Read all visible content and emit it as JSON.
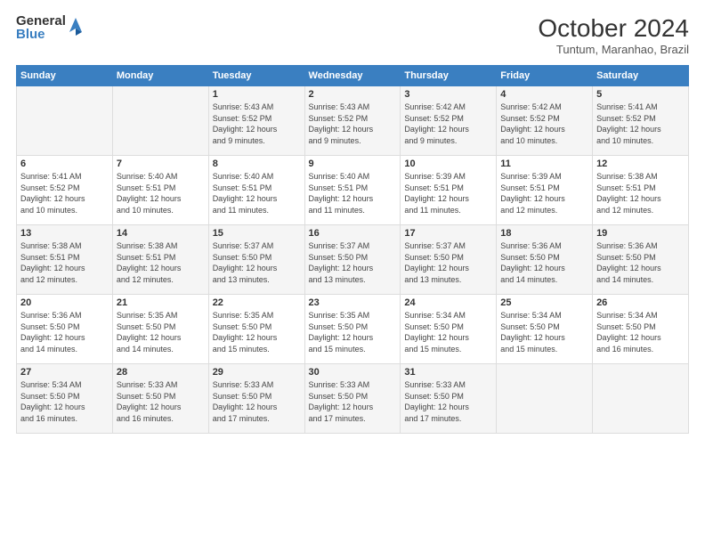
{
  "logo": {
    "general": "General",
    "blue": "Blue"
  },
  "title": "October 2024",
  "location": "Tuntum, Maranhao, Brazil",
  "days_of_week": [
    "Sunday",
    "Monday",
    "Tuesday",
    "Wednesday",
    "Thursday",
    "Friday",
    "Saturday"
  ],
  "weeks": [
    [
      {
        "day": "",
        "info": ""
      },
      {
        "day": "",
        "info": ""
      },
      {
        "day": "1",
        "info": "Sunrise: 5:43 AM\nSunset: 5:52 PM\nDaylight: 12 hours\nand 9 minutes."
      },
      {
        "day": "2",
        "info": "Sunrise: 5:43 AM\nSunset: 5:52 PM\nDaylight: 12 hours\nand 9 minutes."
      },
      {
        "day": "3",
        "info": "Sunrise: 5:42 AM\nSunset: 5:52 PM\nDaylight: 12 hours\nand 9 minutes."
      },
      {
        "day": "4",
        "info": "Sunrise: 5:42 AM\nSunset: 5:52 PM\nDaylight: 12 hours\nand 10 minutes."
      },
      {
        "day": "5",
        "info": "Sunrise: 5:41 AM\nSunset: 5:52 PM\nDaylight: 12 hours\nand 10 minutes."
      }
    ],
    [
      {
        "day": "6",
        "info": "Sunrise: 5:41 AM\nSunset: 5:52 PM\nDaylight: 12 hours\nand 10 minutes."
      },
      {
        "day": "7",
        "info": "Sunrise: 5:40 AM\nSunset: 5:51 PM\nDaylight: 12 hours\nand 10 minutes."
      },
      {
        "day": "8",
        "info": "Sunrise: 5:40 AM\nSunset: 5:51 PM\nDaylight: 12 hours\nand 11 minutes."
      },
      {
        "day": "9",
        "info": "Sunrise: 5:40 AM\nSunset: 5:51 PM\nDaylight: 12 hours\nand 11 minutes."
      },
      {
        "day": "10",
        "info": "Sunrise: 5:39 AM\nSunset: 5:51 PM\nDaylight: 12 hours\nand 11 minutes."
      },
      {
        "day": "11",
        "info": "Sunrise: 5:39 AM\nSunset: 5:51 PM\nDaylight: 12 hours\nand 12 minutes."
      },
      {
        "day": "12",
        "info": "Sunrise: 5:38 AM\nSunset: 5:51 PM\nDaylight: 12 hours\nand 12 minutes."
      }
    ],
    [
      {
        "day": "13",
        "info": "Sunrise: 5:38 AM\nSunset: 5:51 PM\nDaylight: 12 hours\nand 12 minutes."
      },
      {
        "day": "14",
        "info": "Sunrise: 5:38 AM\nSunset: 5:51 PM\nDaylight: 12 hours\nand 12 minutes."
      },
      {
        "day": "15",
        "info": "Sunrise: 5:37 AM\nSunset: 5:50 PM\nDaylight: 12 hours\nand 13 minutes."
      },
      {
        "day": "16",
        "info": "Sunrise: 5:37 AM\nSunset: 5:50 PM\nDaylight: 12 hours\nand 13 minutes."
      },
      {
        "day": "17",
        "info": "Sunrise: 5:37 AM\nSunset: 5:50 PM\nDaylight: 12 hours\nand 13 minutes."
      },
      {
        "day": "18",
        "info": "Sunrise: 5:36 AM\nSunset: 5:50 PM\nDaylight: 12 hours\nand 14 minutes."
      },
      {
        "day": "19",
        "info": "Sunrise: 5:36 AM\nSunset: 5:50 PM\nDaylight: 12 hours\nand 14 minutes."
      }
    ],
    [
      {
        "day": "20",
        "info": "Sunrise: 5:36 AM\nSunset: 5:50 PM\nDaylight: 12 hours\nand 14 minutes."
      },
      {
        "day": "21",
        "info": "Sunrise: 5:35 AM\nSunset: 5:50 PM\nDaylight: 12 hours\nand 14 minutes."
      },
      {
        "day": "22",
        "info": "Sunrise: 5:35 AM\nSunset: 5:50 PM\nDaylight: 12 hours\nand 15 minutes."
      },
      {
        "day": "23",
        "info": "Sunrise: 5:35 AM\nSunset: 5:50 PM\nDaylight: 12 hours\nand 15 minutes."
      },
      {
        "day": "24",
        "info": "Sunrise: 5:34 AM\nSunset: 5:50 PM\nDaylight: 12 hours\nand 15 minutes."
      },
      {
        "day": "25",
        "info": "Sunrise: 5:34 AM\nSunset: 5:50 PM\nDaylight: 12 hours\nand 15 minutes."
      },
      {
        "day": "26",
        "info": "Sunrise: 5:34 AM\nSunset: 5:50 PM\nDaylight: 12 hours\nand 16 minutes."
      }
    ],
    [
      {
        "day": "27",
        "info": "Sunrise: 5:34 AM\nSunset: 5:50 PM\nDaylight: 12 hours\nand 16 minutes."
      },
      {
        "day": "28",
        "info": "Sunrise: 5:33 AM\nSunset: 5:50 PM\nDaylight: 12 hours\nand 16 minutes."
      },
      {
        "day": "29",
        "info": "Sunrise: 5:33 AM\nSunset: 5:50 PM\nDaylight: 12 hours\nand 17 minutes."
      },
      {
        "day": "30",
        "info": "Sunrise: 5:33 AM\nSunset: 5:50 PM\nDaylight: 12 hours\nand 17 minutes."
      },
      {
        "day": "31",
        "info": "Sunrise: 5:33 AM\nSunset: 5:50 PM\nDaylight: 12 hours\nand 17 minutes."
      },
      {
        "day": "",
        "info": ""
      },
      {
        "day": "",
        "info": ""
      }
    ]
  ]
}
